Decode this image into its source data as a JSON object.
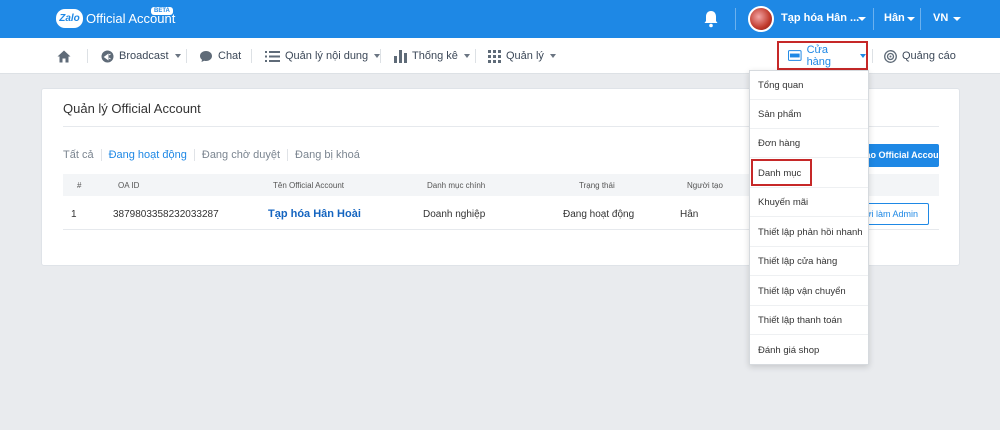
{
  "topbar": {
    "logo_text": "Zalo",
    "brand": "Official Account",
    "beta": "BETA",
    "account_name": "Tạp hóa Hân ...",
    "user": "Hân",
    "language": "VN"
  },
  "nav": {
    "broadcast": "Broadcast",
    "chat": "Chat",
    "content": "Quản lý nội dung",
    "stats": "Thống kê",
    "manage": "Quản lý",
    "store": "Cửa hàng",
    "ads": "Quảng cáo"
  },
  "card": {
    "title": "Quản lý Official Account",
    "filters": [
      "Tất cả",
      "Đang hoạt động",
      "Đang chờ duyệt",
      "Đang bị khoá"
    ],
    "new_button": "Tạo Official Account mới",
    "columns": [
      "#",
      "OA ID",
      "Tên Official Account",
      "Danh mục chính",
      "Trạng thái",
      "Người tạo"
    ],
    "rows": [
      {
        "index": "1",
        "oa_id": "3879803358232033287",
        "name": "Tạp hóa Hân Hoài",
        "category": "Doanh nghiệp",
        "status": "Đang hoạt động",
        "creator": "Hân",
        "action": "Mời làm Admin"
      }
    ]
  },
  "store_menu": {
    "items": [
      "Tổng quan",
      "Sản phẩm",
      "Đơn hàng",
      "Danh mục",
      "Khuyến mãi",
      "Thiết lập phản hồi nhanh",
      "Thiết lập cửa hàng",
      "Thiết lập vận chuyển",
      "Thiết lập thanh toán",
      "Đánh giá shop"
    ],
    "highlighted": "Danh mục"
  },
  "colors": {
    "primary": "#1e88e5",
    "highlight_border": "#c62828",
    "background": "#e9ebee"
  }
}
